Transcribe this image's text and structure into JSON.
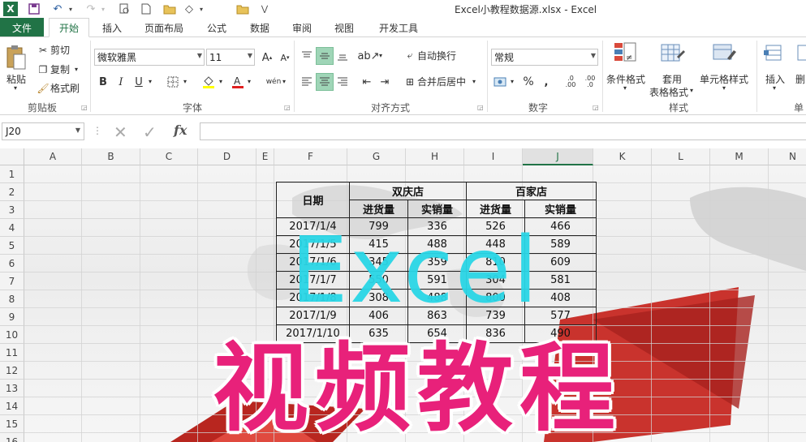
{
  "titlebar": {
    "logo_letter": "X",
    "title": "Excel小教程数据源.xlsx - Excel"
  },
  "tabs": [
    "文件",
    "开始",
    "插入",
    "页面布局",
    "公式",
    "数据",
    "审阅",
    "视图",
    "开发工具"
  ],
  "ribbon": {
    "groups": [
      "剪贴板",
      "字体",
      "对齐方式",
      "数字",
      "样式",
      "单"
    ],
    "clipboard": {
      "paste": "粘贴",
      "cut": "剪切",
      "copy": "复制",
      "format_painter": "格式刷"
    },
    "font": {
      "name": "微软雅黑",
      "size": "11",
      "bold": "B",
      "italic": "I",
      "underline": "U",
      "phonetic": "wén"
    },
    "alignment": {
      "wrap_text": "自动换行",
      "merge_center": "合并后居中"
    },
    "number": {
      "format": "常规",
      "percent": "%",
      "comma": ",",
      "inc_dec_top": ".0",
      "inc_dec_bottom": ".00",
      "dec_dec_top": ".00",
      "dec_dec_bottom": ".0"
    },
    "styles": {
      "conditional": "条件格式",
      "format_table_1": "套用",
      "format_table_2": "表格格式",
      "cell_styles": "单元格样式"
    },
    "cells": {
      "insert": "插入",
      "delete_partial": "删"
    }
  },
  "formula_bar": {
    "name_box": "J20",
    "fx": "fx",
    "content": ""
  },
  "grid": {
    "columns": [
      "A",
      "B",
      "C",
      "D",
      "E",
      "F",
      "G",
      "H",
      "I",
      "J",
      "K",
      "L",
      "M",
      "N"
    ],
    "selected_column": "J",
    "rows": [
      "1",
      "2",
      "3",
      "4",
      "5",
      "6",
      "7",
      "8",
      "9",
      "10",
      "11",
      "12",
      "13",
      "14",
      "15",
      "16"
    ]
  },
  "table": {
    "header_date": "日期",
    "store_1": "双庆店",
    "store_2": "百家店",
    "sub_headers": [
      "进货量",
      "实销量",
      "进货量",
      "实销量"
    ],
    "rows": [
      [
        "2017/1/4",
        "799",
        "336",
        "526",
        "466"
      ],
      [
        "2017/1/5",
        "415",
        "488",
        "448",
        "589"
      ],
      [
        "2017/1/6",
        "345",
        "359",
        "810",
        "609"
      ],
      [
        "2017/1/7",
        "550",
        "591",
        "304",
        "581"
      ],
      [
        "2017/1/8",
        "308",
        "488",
        "800",
        "408"
      ],
      [
        "2017/1/9",
        "406",
        "863",
        "739",
        "577"
      ],
      [
        "2017/1/10",
        "635",
        "654",
        "836",
        "490"
      ]
    ]
  },
  "overlay": {
    "excel": "Excel",
    "subtitle": "视频教程"
  }
}
